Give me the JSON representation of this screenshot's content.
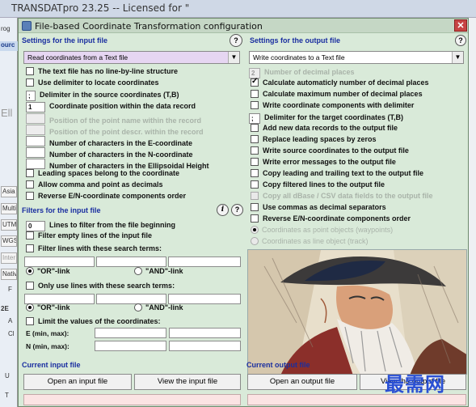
{
  "background_window": {
    "title": "TRANSDATpro 23.25 -- Licensed for \"",
    "left_fragments": [
      "rog",
      "ourc",
      "Ell",
      "Asia",
      "Multi",
      "UTM",
      "WGS",
      "Inter",
      "Nativ",
      "F",
      "2E",
      "A",
      "Cl",
      "U",
      "T"
    ]
  },
  "dialog": {
    "title": "File-based Coordinate Transformation configuration",
    "close_glyph": "✕"
  },
  "input": {
    "heading": "Settings for the input file",
    "help": "?",
    "combo_value": "Read coordinates from a Text file",
    "options": [
      {
        "label": "The text file has no line-by-line structure",
        "checked": false,
        "enabled": true
      },
      {
        "label": "Use delimiter to locate coordinates",
        "checked": false,
        "enabled": true
      },
      {
        "label": "Delimiter in the source coordinates (T,B)",
        "prefix": ";",
        "enabled": true
      },
      {
        "label": "Coordinate position within the data record",
        "prefix": "1",
        "enabled": true
      },
      {
        "label": "Position of the point name within the record",
        "prefix": "",
        "enabled": false
      },
      {
        "label": "Position of the point descr. within the record",
        "prefix": "",
        "enabled": false
      },
      {
        "label": "Number of characters in the E-coordinate",
        "prefix": "",
        "enabled": true
      },
      {
        "label": "Number of characters in the N-coordinate",
        "prefix": "",
        "enabled": true
      },
      {
        "label": "Number of characters in the Ellipsoidal Height",
        "prefix": "",
        "enabled": true
      },
      {
        "label": "Leading spaces belong to the coordinate",
        "checked": false,
        "enabled": true
      },
      {
        "label": "Allow comma and point as decimals",
        "checked": false,
        "enabled": true
      },
      {
        "label": "Reverse E/N-coordinate components order",
        "checked": false,
        "enabled": true
      }
    ]
  },
  "filters": {
    "heading": "Filters for the input file",
    "info": "i",
    "help": "?",
    "lines_to_filter_value": "0",
    "lines_to_filter_label": "Lines to filter from the file beginning",
    "filter_empty": "Filter empty lines of the input file",
    "filter_search": "Filter lines with these search terms:",
    "or_link": "\"OR\"-link",
    "and_link": "\"AND\"-link",
    "only_use": "Only use lines with these search terms:",
    "limit_values": "Limit the values of the coordinates:",
    "e_label": "E (min, max):",
    "n_label": "N (min, max):"
  },
  "output": {
    "heading": "Settings for the output file",
    "help": "?",
    "combo_value": "Write coordinates to a Text file",
    "decimal_places_value": "2",
    "decimal_places_label": "Number of decimal places",
    "options": [
      {
        "label": "Calculate automaticly number of decimal places",
        "checked": true,
        "enabled": true
      },
      {
        "label": "Calculate maximum number of decimal places",
        "checked": false,
        "enabled": true
      },
      {
        "label": "Write coordinate components with delimiter",
        "checked": false,
        "enabled": true
      },
      {
        "label": "Delimiter for the target coordinates (T,B)",
        "prefix": ";",
        "enabled": true
      },
      {
        "label": "Add new data records to the output file",
        "checked": false,
        "enabled": true
      },
      {
        "label": "Replace leading spaces by zeros",
        "checked": false,
        "enabled": true
      },
      {
        "label": "Write source coordinates to the output file",
        "checked": false,
        "enabled": true
      },
      {
        "label": "Write error messages to the output file",
        "checked": false,
        "enabled": true
      },
      {
        "label": "Copy leading and trailing text to the output file",
        "checked": false,
        "enabled": true
      },
      {
        "label": "Copy filtered lines to the output file",
        "checked": false,
        "enabled": true
      },
      {
        "label": "Copy all dBase / CSV data fields to the output file",
        "checked": false,
        "enabled": false
      },
      {
        "label": "Use commas as decimal separators",
        "checked": false,
        "enabled": true
      },
      {
        "label": "Reverse E/N-coordinate components order",
        "checked": false,
        "enabled": true
      }
    ],
    "radio_points": "Coordinates as point objects (waypoints)",
    "radio_line": "Coordinates as line object (track)"
  },
  "current_input": {
    "heading": "Current input file",
    "open_button": "Open an input file",
    "view_button": "View the input file"
  },
  "current_output": {
    "heading": "Current output file",
    "open_button": "Open an output file",
    "view_button": "View the output file"
  },
  "watermark": "最需网",
  "colors": {
    "dialog_bg": "#d9ead9",
    "heading_blue": "#1a2ea0",
    "combo_highlight": "#e6d6f2"
  }
}
